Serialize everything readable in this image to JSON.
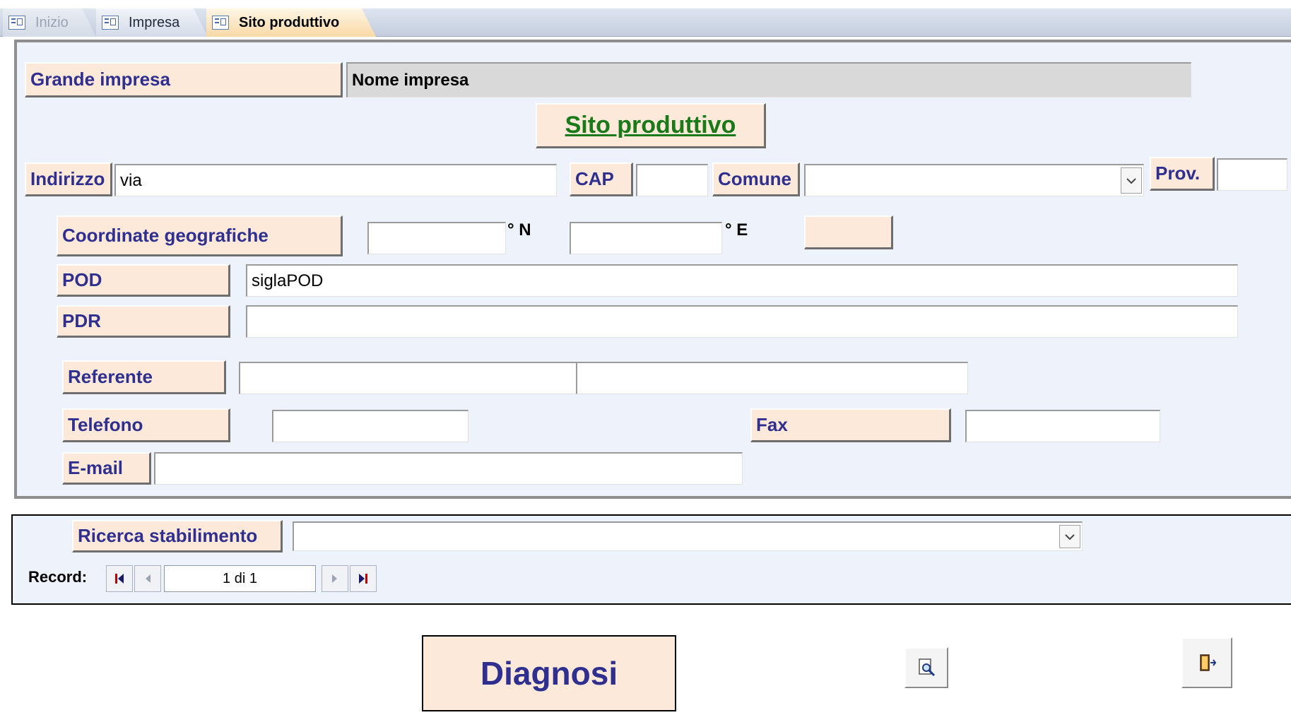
{
  "tabs": [
    {
      "label": "Inizio",
      "state": "disabled"
    },
    {
      "label": "Impresa",
      "state": "normal"
    },
    {
      "label": "Sito produttivo",
      "state": "active"
    }
  ],
  "form": {
    "company_label": "Grande impresa",
    "company_name_value": "Nome impresa",
    "section_title": "Sito produttivo",
    "address": {
      "label": "Indirizzo",
      "value": "via"
    },
    "cap": {
      "label": "CAP",
      "value": ""
    },
    "comune": {
      "label": "Comune",
      "value": ""
    },
    "prov": {
      "label": "Prov.",
      "value": ""
    },
    "coords": {
      "label": "Coordinate geografiche",
      "n_value": "",
      "n_suffix": "° N",
      "e_value": "",
      "e_suffix": "° E",
      "extra_button_label": ""
    },
    "pod": {
      "label": "POD",
      "value": "siglaPOD"
    },
    "pdr": {
      "label": "PDR",
      "value": ""
    },
    "referente": {
      "label": "Referente",
      "first_value": "",
      "second_value": ""
    },
    "telefono": {
      "label": "Telefono",
      "value": ""
    },
    "fax": {
      "label": "Fax",
      "value": ""
    },
    "email": {
      "label": "E-mail",
      "value": ""
    }
  },
  "search": {
    "label": "Ricerca stabilimento",
    "value": ""
  },
  "record_nav": {
    "label": "Record:",
    "position": "1 di 1"
  },
  "actions": {
    "diagnosi_label": "Diagnosi",
    "preview_icon": "print-preview-icon",
    "exit_icon": "exit-door-icon"
  },
  "colors": {
    "label_bg": "#fde9d9",
    "label_text": "#2f2f8f",
    "section_title_text": "#1a7a1a",
    "panel_bg": "#eef3fb",
    "active_tab": "#f8d9a6"
  }
}
